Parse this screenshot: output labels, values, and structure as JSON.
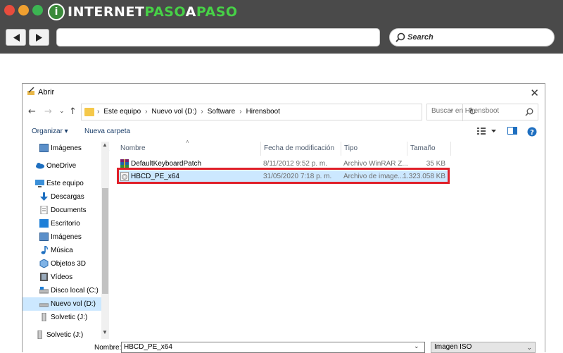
{
  "browser": {
    "logo_part1": "INTERNET",
    "logo_part2": "PASO",
    "logo_part3": "A",
    "logo_part4": "PASO",
    "search_label": "Search",
    "colors": {
      "chrome": "#4a4a4a",
      "accent_green": "#47d147"
    }
  },
  "dialog": {
    "title": "Abrir",
    "breadcrumbs": [
      "Este equipo",
      "Nuevo vol (D:)",
      "Software",
      "Hirensboot"
    ],
    "search_placeholder": "Buscar en Hirensboot",
    "toolbar": {
      "organize": "Organizar ▾",
      "new_folder": "Nueva carpeta"
    },
    "nav": {
      "items": [
        {
          "label": "Imágenes",
          "icon": "pictures-icon"
        },
        {
          "label": "OneDrive",
          "icon": "cloud-icon"
        },
        {
          "label": "Este equipo",
          "icon": "computer-icon"
        },
        {
          "label": "Descargas",
          "icon": "download-icon"
        },
        {
          "label": "Documents",
          "icon": "document-icon"
        },
        {
          "label": "Escritorio",
          "icon": "desktop-icon"
        },
        {
          "label": "Imágenes",
          "icon": "pictures-icon"
        },
        {
          "label": "Música",
          "icon": "music-icon"
        },
        {
          "label": "Objetos 3D",
          "icon": "cube-icon"
        },
        {
          "label": "Vídeos",
          "icon": "video-icon"
        },
        {
          "label": "Disco local (C:)",
          "icon": "drive-icon"
        },
        {
          "label": "Nuevo vol (D:)",
          "icon": "drive-icon"
        },
        {
          "label": "Solvetic (J:)",
          "icon": "usb-drive-icon"
        },
        {
          "label": "Solvetic (J:)",
          "icon": "usb-drive-icon"
        }
      ]
    },
    "columns": {
      "name": "Nombre",
      "date": "Fecha de modificación",
      "type": "Tipo",
      "size": "Tamaño"
    },
    "files": [
      {
        "name": "DefaultKeyboardPatch",
        "date": "8/11/2012 9:52 p. m.",
        "type": "Archivo WinRAR Z...",
        "size": "35 KB",
        "icon": "winrar-icon"
      },
      {
        "name": "HBCD_PE_x64",
        "date": "31/05/2020 7:18 p. m.",
        "type": "Archivo de image...",
        "size": "1.323.058 KB",
        "icon": "disc-image-icon"
      }
    ],
    "footer": {
      "name_label": "Nombre:",
      "name_value": "HBCD_PE_x64",
      "file_type": "Imagen ISO"
    }
  }
}
